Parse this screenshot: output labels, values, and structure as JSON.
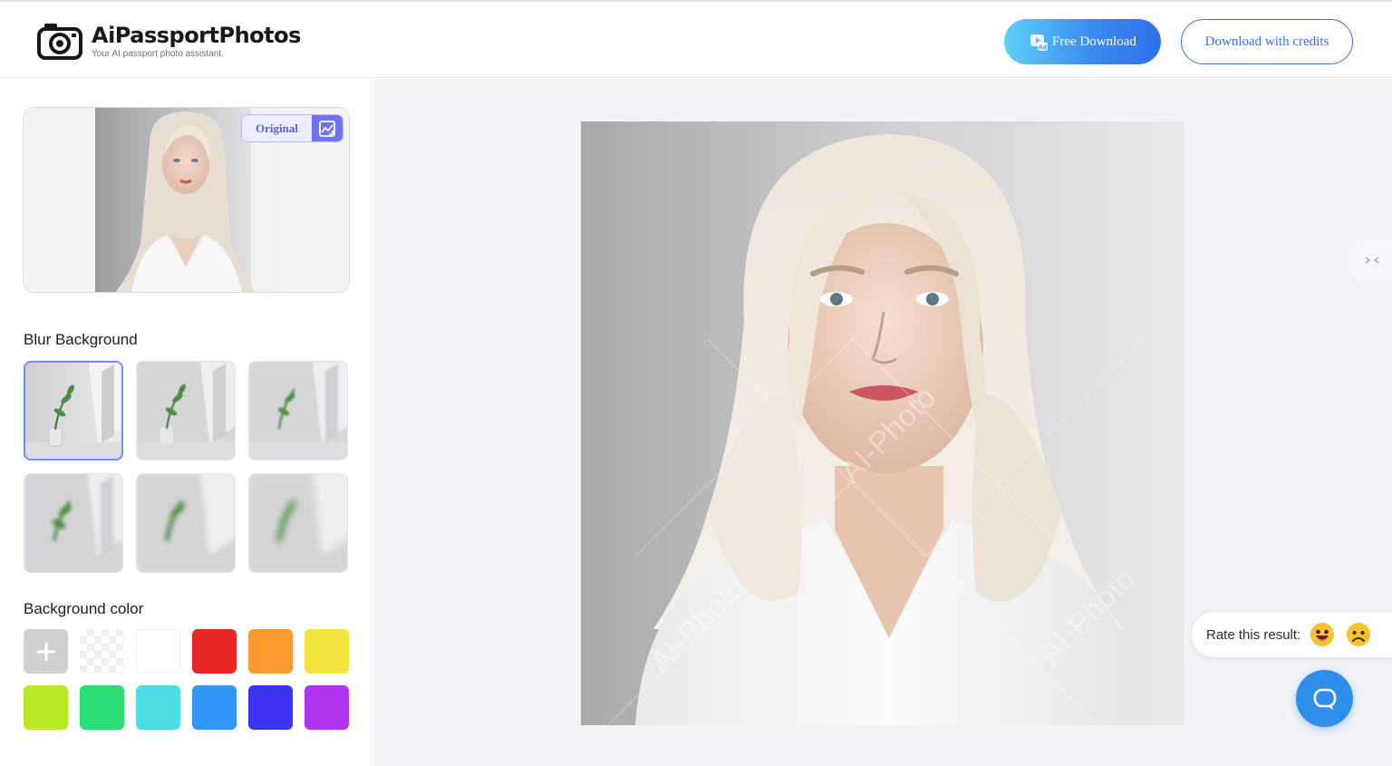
{
  "header": {
    "brand_title": "AiPassportPhotos",
    "brand_subtitle": "Your AI passport photo assistant.",
    "free_download_label": "Free Download",
    "download_credits_label": "Download with credits",
    "free_badge_text": "Ad"
  },
  "sidebar": {
    "original_toggle_label": "Original",
    "blur_title": "Blur Background",
    "blur_options_count": 6,
    "selected_blur_index": 0,
    "color_title": "Background color",
    "colors": [
      {
        "name": "add",
        "hex": "#d0d0d3"
      },
      {
        "name": "transparent",
        "hex": "transparent"
      },
      {
        "name": "white",
        "hex": "#ffffff"
      },
      {
        "name": "red",
        "hex": "#e82727"
      },
      {
        "name": "orange",
        "hex": "#fc9a30"
      },
      {
        "name": "yellow",
        "hex": "#f5e33d"
      },
      {
        "name": "lime",
        "hex": "#b9e826"
      },
      {
        "name": "green",
        "hex": "#2cdc74"
      },
      {
        "name": "cyan",
        "hex": "#4ddce3"
      },
      {
        "name": "blue",
        "hex": "#3395f5"
      },
      {
        "name": "indigo",
        "hex": "#3b33f0"
      },
      {
        "name": "purple",
        "hex": "#b033f0"
      }
    ]
  },
  "main": {
    "watermark_text": "AI-Photo",
    "rate_label": "Rate this result:"
  },
  "colors": {
    "accent": "#3d6ef0",
    "toggle_accent": "#6f74ee",
    "chat": "#2f8ee9"
  }
}
